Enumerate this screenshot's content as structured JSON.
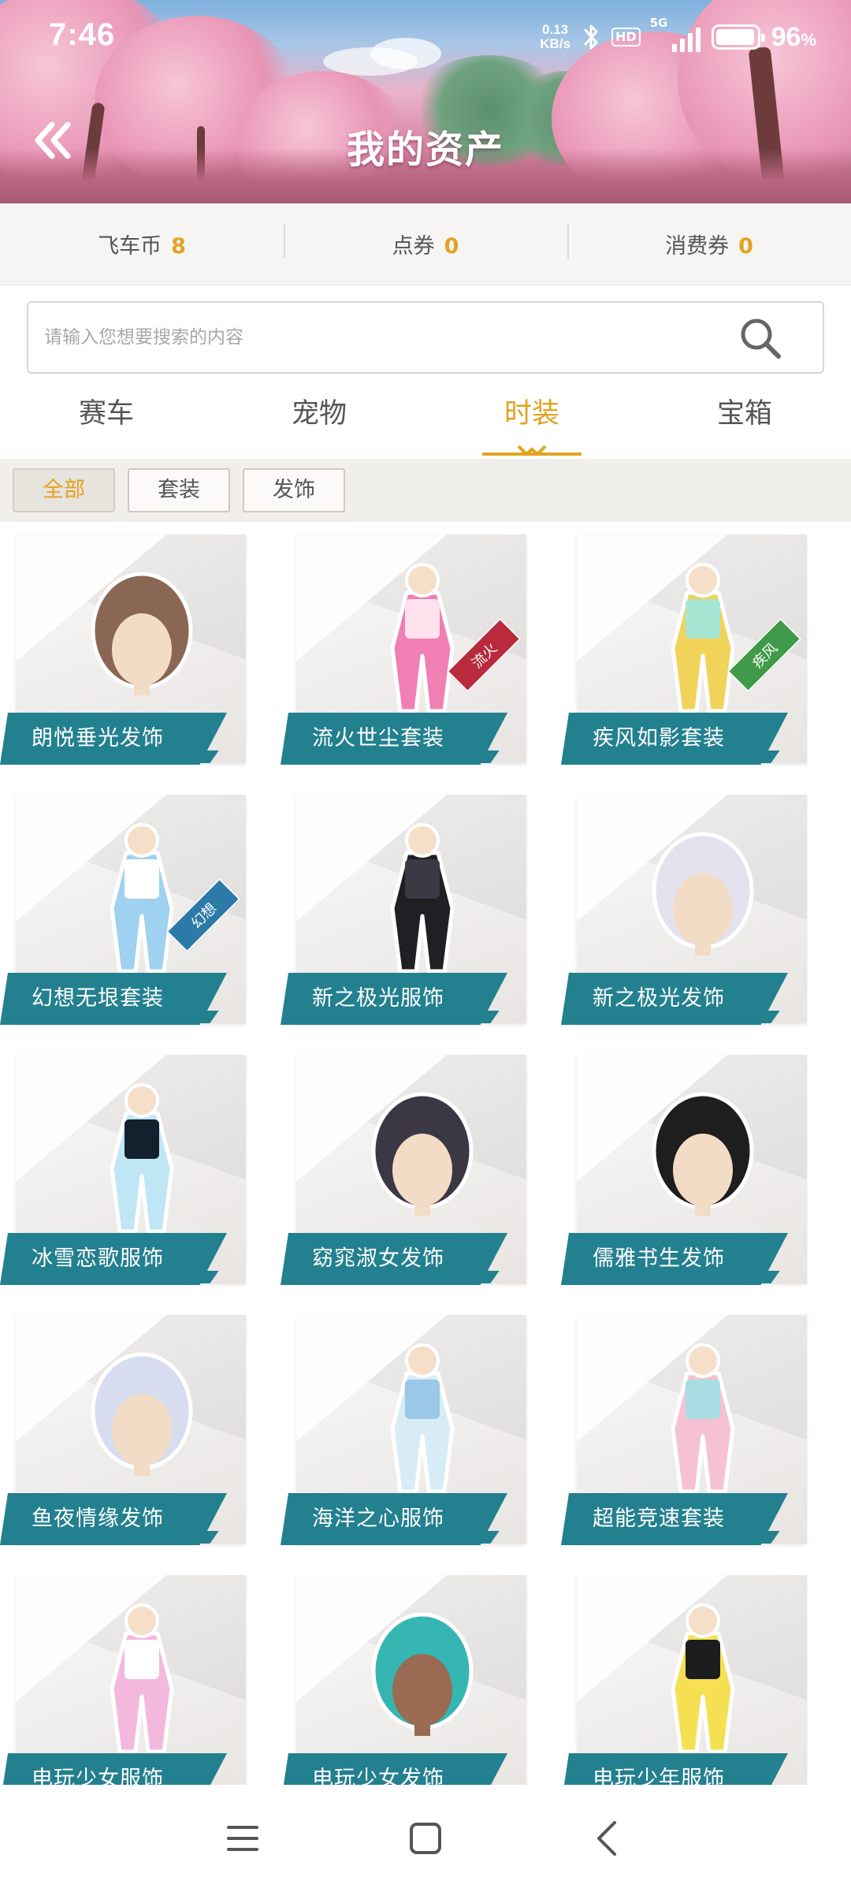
{
  "status_bar": {
    "time": "7:46",
    "net_speed_value": "0.13",
    "net_speed_unit": "KB/s",
    "hd_label": "HD",
    "signal_label": "5G",
    "battery_value": "96",
    "battery_unit": "%",
    "icons": [
      "bluetooth-icon",
      "hd-icon",
      "signal-icon",
      "battery-icon"
    ]
  },
  "header": {
    "title": "我的资产",
    "back_icon": "double-chevron-left-icon"
  },
  "currencies": [
    {
      "label": "飞车币",
      "value": "8"
    },
    {
      "label": "点券",
      "value": "0"
    },
    {
      "label": "消费券",
      "value": "0"
    }
  ],
  "search": {
    "placeholder": "请输入您想要搜索的内容",
    "icon": "search-icon"
  },
  "tabs": [
    {
      "label": "赛车",
      "active": false
    },
    {
      "label": "宠物",
      "active": false
    },
    {
      "label": "时装",
      "active": true
    },
    {
      "label": "宝箱",
      "active": false
    }
  ],
  "filters": [
    {
      "label": "全部",
      "active": true
    },
    {
      "label": "套装",
      "active": false
    },
    {
      "label": "发饰",
      "active": false
    }
  ],
  "items": [
    {
      "name": "朗悦垂光发饰",
      "art": "hair-bun-brown-icon"
    },
    {
      "name": "流火世尘套装",
      "art": "pink-suit-icon",
      "badge": "流火",
      "badge_color": "#b82a3c"
    },
    {
      "name": "疾风如影套装",
      "art": "green-suit-icon",
      "badge": "疾风",
      "badge_color": "#3f9a4a"
    },
    {
      "name": "幻想无垠套装",
      "art": "blue-suit-icon",
      "badge": "幻想",
      "badge_color": "#2c7aa8"
    },
    {
      "name": "新之极光服饰",
      "art": "black-suit-icon"
    },
    {
      "name": "新之极光发饰",
      "art": "hair-white-icon"
    },
    {
      "name": "冰雪恋歌服饰",
      "art": "ice-outfit-icon"
    },
    {
      "name": "窈窕淑女发饰",
      "art": "hair-black-icon"
    },
    {
      "name": "儒雅书生发饰",
      "art": "beanie-hat-icon"
    },
    {
      "name": "鱼夜情缘发饰",
      "art": "hair-silver-icon"
    },
    {
      "name": "海洋之心服饰",
      "art": "ocean-dress-icon"
    },
    {
      "name": "超能竞速套装",
      "art": "racer-suit-icon"
    },
    {
      "name": "电玩少女服饰",
      "art": "gamer-girl-outfit-icon"
    },
    {
      "name": "电玩少女发饰",
      "art": "gamer-girl-hair-icon"
    },
    {
      "name": "电玩少年服饰",
      "art": "gamer-boy-outfit-icon"
    }
  ],
  "nav": {
    "icons": [
      "menu-icon",
      "home-square-icon",
      "back-arrow-icon"
    ]
  },
  "colors": {
    "accent": "#e3a220",
    "label_teal": "#23808f",
    "text_dark": "#555555"
  }
}
